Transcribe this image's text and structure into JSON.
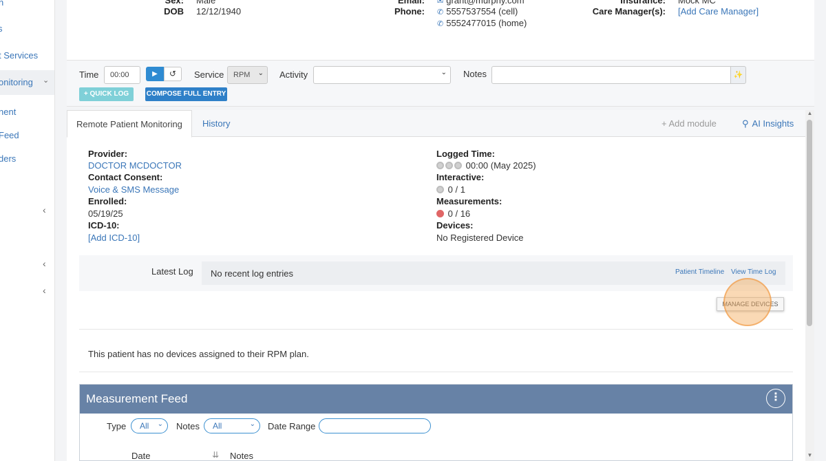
{
  "sidebar": {
    "items": [
      {
        "label": "n"
      },
      {
        "label": "s"
      },
      {
        "label": "t Services"
      },
      {
        "label": "onitoring"
      },
      {
        "label": "nent"
      },
      {
        "label": " Feed"
      },
      {
        "label": "ders"
      }
    ]
  },
  "patient": {
    "sex_label": "Sex:",
    "sex_value": "Male",
    "dob_label": "DOB",
    "dob_value": "12/12/1940",
    "email_label": "Email:",
    "email_value": "grant@murphy.com",
    "phone_label": "Phone:",
    "phone_cell": "5557537554 (cell)",
    "phone_home": "5552477015 (home)",
    "insurance_label": "Insurance:",
    "insurance_value": "Mock MC",
    "care_manager_label": "Care Manager(s):",
    "care_manager_value": "[Add Care Manager]"
  },
  "timebar": {
    "time_label": "Time",
    "time_value": "00:00",
    "service_label": "Service",
    "service_value": "RPM",
    "activity_label": "Activity",
    "activity_value": "",
    "notes_label": "Notes",
    "notes_value": "",
    "quick_log": "+ QUICK LOG",
    "compose": "COMPOSE FULL ENTRY"
  },
  "tabs": {
    "active": "Remote Patient Monitoring",
    "history": "History",
    "add_module": "+ Add module",
    "ai_insights": "AI Insights"
  },
  "rpm": {
    "provider_label": "Provider:",
    "provider_value": "DOCTOR MCDOCTOR",
    "consent_label": "Contact Consent:",
    "consent_value": "Voice & SMS Message",
    "enrolled_label": "Enrolled:",
    "enrolled_value": "05/19/25",
    "icd_label": "ICD-10:",
    "icd_value": "[Add ICD-10]",
    "logged_label": "Logged Time:",
    "logged_value": "00:00 (May 2025)",
    "interactive_label": "Interactive:",
    "interactive_value": "0 / 1",
    "measurements_label": "Measurements:",
    "measurements_value": "0 / 16",
    "devices_label": "Devices:",
    "devices_value": "No Registered Device",
    "latest_log_label": "Latest Log",
    "latest_log_value": "No recent log entries",
    "patient_timeline": "Patient Timeline",
    "view_time_log": "View Time Log",
    "manage_devices": "MANAGE DEVICES",
    "no_devices_msg": "This patient has no devices assigned to their RPM plan."
  },
  "feed": {
    "title": "Measurement Feed",
    "type_label": "Type",
    "type_value": "All",
    "notes_label": "Notes",
    "notes_value": "All",
    "date_range_label": "Date Range",
    "col_date": "Date",
    "col_notes": "Notes"
  },
  "colors": {
    "primary": "#2f80c8",
    "feed_header": "#6782a6",
    "link": "#3a76b8",
    "alert": "#e06666"
  }
}
